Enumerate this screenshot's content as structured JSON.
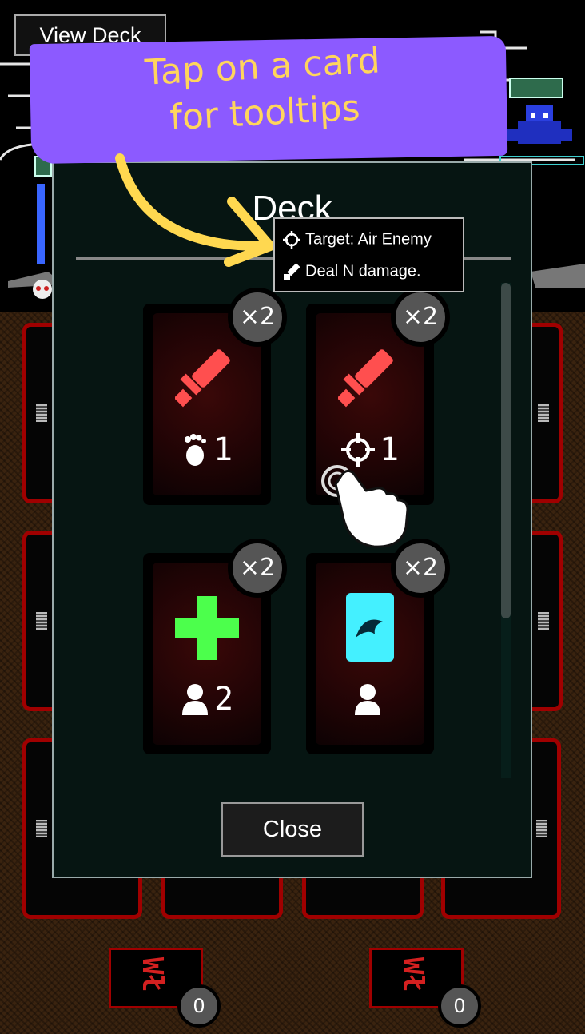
{
  "top_bar": {
    "view_deck_label": "View Deck"
  },
  "banner": {
    "line1": "Tap on a card",
    "line2": "for tooltips"
  },
  "deck_modal": {
    "title": "Deck",
    "close_label": "Close",
    "cards": [
      {
        "quantity": "×2",
        "effect_icon": "sword-icon",
        "effect_color": "#ff4f4f",
        "cost_icon": "footprint-icon",
        "cost": "1"
      },
      {
        "quantity": "×2",
        "effect_icon": "sword-icon",
        "effect_color": "#ff4f4f",
        "cost_icon": "crosshair-icon",
        "cost": "1"
      },
      {
        "quantity": "×2",
        "effect_icon": "plus-icon",
        "effect_color": "#4cff4c",
        "cost_icon": "person-icon",
        "cost": "2"
      },
      {
        "quantity": "×2",
        "effect_icon": "wave-card-icon",
        "effect_color": "#44f0ff",
        "cost_icon": "person-icon",
        "cost": ""
      }
    ]
  },
  "tooltip": {
    "target_text": "Target: Air Enemy",
    "effect_text": "Deal N damage."
  },
  "bottom_slots": [
    {
      "count": "0"
    },
    {
      "count": "0"
    }
  ],
  "colors": {
    "accent_banner": "#8c5aff",
    "banner_text": "#ffd55c",
    "card_border_red": "#a00000",
    "modal_bg": "#061512"
  }
}
